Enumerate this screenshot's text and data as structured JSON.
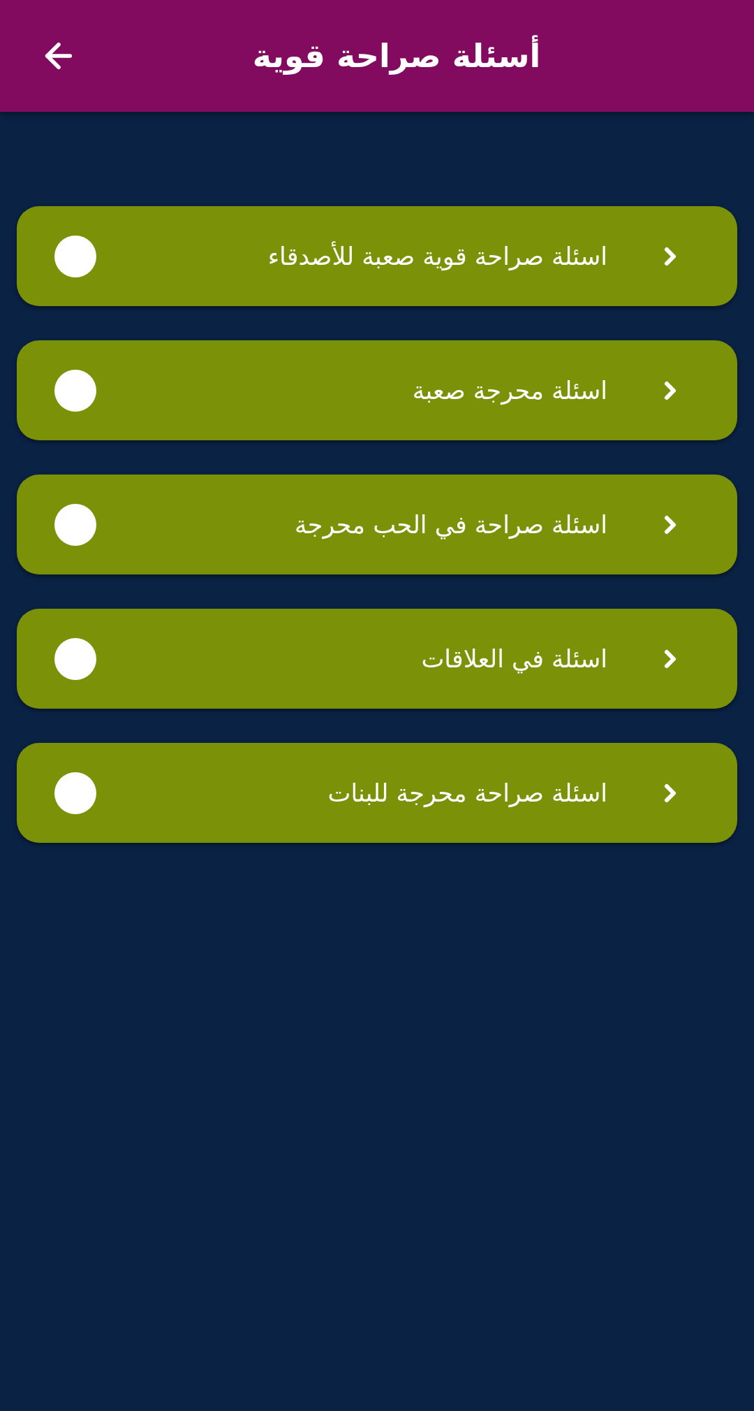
{
  "app_bar": {
    "title": "أسئلة صراحة قوية"
  },
  "items": [
    {
      "label": "اسئلة صراحة قوية صعبة للأصدقاء"
    },
    {
      "label": "اسئلة محرجة صعبة"
    },
    {
      "label": "اسئلة صراحة في الحب محرجة"
    },
    {
      "label": "اسئلة في العلاقات"
    },
    {
      "label": "اسئلة صراحة محرجة للبنات"
    }
  ]
}
